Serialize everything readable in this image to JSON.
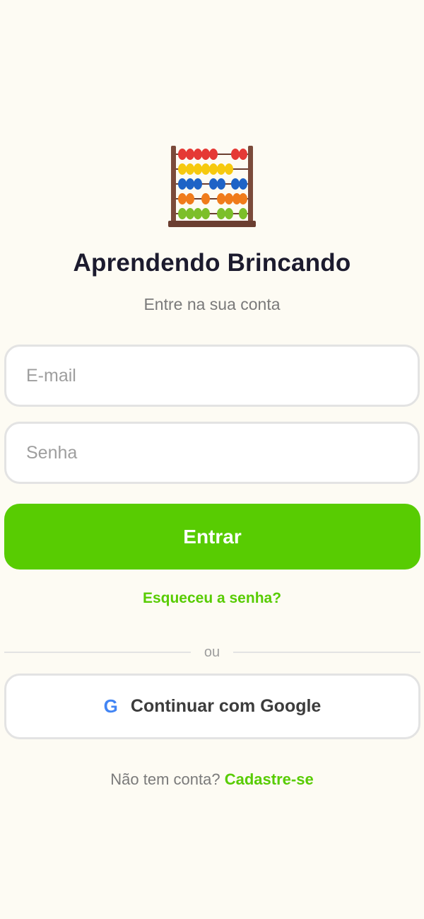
{
  "app": {
    "logo_icon": "abacus-icon",
    "title": "Aprendendo Brincando",
    "subtitle": "Entre na sua conta"
  },
  "form": {
    "email_placeholder": "E-mail",
    "email_value": "",
    "password_placeholder": "Senha",
    "password_value": "",
    "submit_label": "Entrar",
    "forgot_label": "Esqueceu a senha?"
  },
  "divider": {
    "label": "ou"
  },
  "google": {
    "icon": "google-icon",
    "icon_glyph": "G",
    "label": "Continuar com Google"
  },
  "signup": {
    "prompt": "Não tem conta?",
    "link_label": "Cadastre-se"
  },
  "colors": {
    "background": "#fdfbf3",
    "accent": "#58cc02",
    "title": "#1c1b2e",
    "muted": "#7a7a7a",
    "google_blue": "#4285f4"
  }
}
